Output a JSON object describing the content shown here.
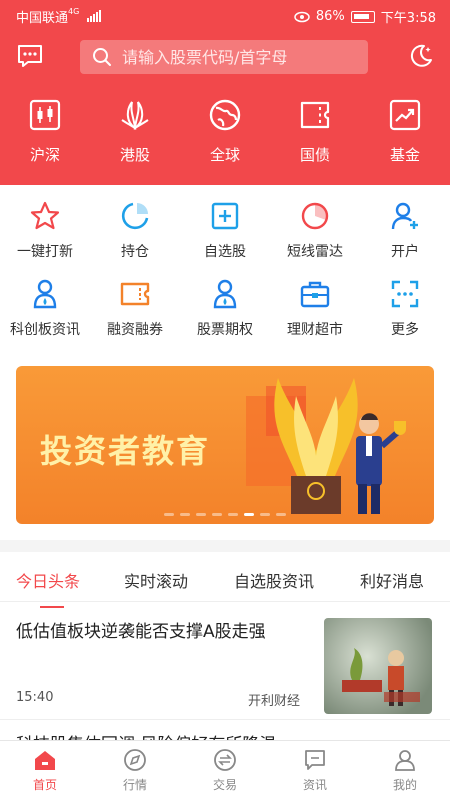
{
  "status_bar": {
    "carrier": "中国联通",
    "network": "4G",
    "battery": "86%",
    "time": "下午3:58"
  },
  "search": {
    "placeholder": "请输入股票代码/首字母"
  },
  "markets": [
    {
      "label": "沪深",
      "icon": "candlestick-icon"
    },
    {
      "label": "港股",
      "icon": "bauhinia-icon"
    },
    {
      "label": "全球",
      "icon": "globe-icon"
    },
    {
      "label": "国债",
      "icon": "ticket-icon"
    },
    {
      "label": "基金",
      "icon": "trend-chart-icon"
    }
  ],
  "functions": [
    {
      "label": "一键打新",
      "icon": "star-icon",
      "color": "#f2484b"
    },
    {
      "label": "持仓",
      "icon": "pie-icon",
      "color": "#1ea0e8"
    },
    {
      "label": "自选股",
      "icon": "add-square-icon",
      "color": "#1ea0e8"
    },
    {
      "label": "短线雷达",
      "icon": "radar-icon",
      "color": "#f2484b"
    },
    {
      "label": "开户",
      "icon": "add-user-icon",
      "color": "#1e7fe8"
    },
    {
      "label": "科创板资讯",
      "icon": "user-badge-icon",
      "color": "#1e7fe8"
    },
    {
      "label": "融资融券",
      "icon": "coupon-icon",
      "color": "#f3822a"
    },
    {
      "label": "股票期权",
      "icon": "person-icon",
      "color": "#1e7fe8"
    },
    {
      "label": "理财超市",
      "icon": "briefcase-icon",
      "color": "#1e7fe8"
    },
    {
      "label": "更多",
      "icon": "more-grid-icon",
      "color": "#1ea0e8"
    }
  ],
  "banner": {
    "title": "投资者教育",
    "slides": 8,
    "active_slide": 5
  },
  "tabs": [
    {
      "label": "今日头条",
      "active": true
    },
    {
      "label": "实时滚动",
      "active": false
    },
    {
      "label": "自选股资讯",
      "active": false
    },
    {
      "label": "利好消息",
      "active": false
    }
  ],
  "news": [
    {
      "title": "低估值板块逆袭能否支撑A股走强",
      "time": "15:40",
      "source": "开利财经"
    },
    {
      "title": "科技股集体回调 风险偏好有所降温",
      "time": "",
      "source": ""
    }
  ],
  "bottom_nav": [
    {
      "label": "首页",
      "icon": "home-icon",
      "active": true
    },
    {
      "label": "行情",
      "icon": "compass-icon",
      "active": false
    },
    {
      "label": "交易",
      "icon": "exchange-icon",
      "active": false
    },
    {
      "label": "资讯",
      "icon": "chat-icon",
      "active": false
    },
    {
      "label": "我的",
      "icon": "profile-icon",
      "active": false
    }
  ]
}
